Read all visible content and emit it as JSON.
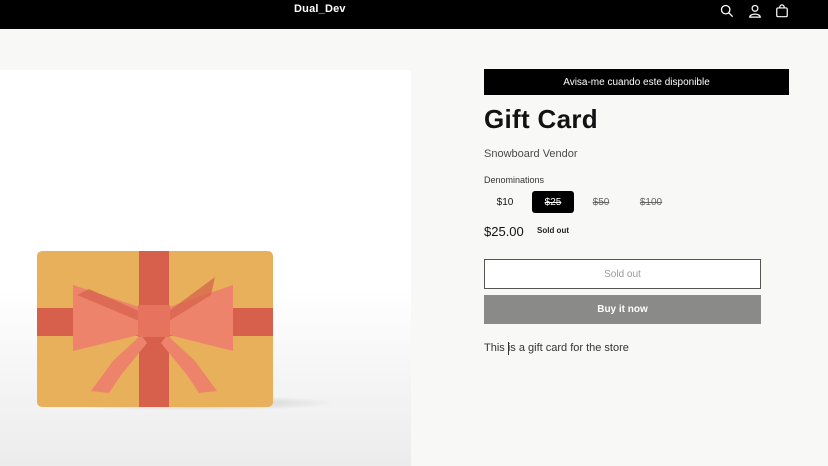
{
  "header": {
    "brand": "Dual_Dev",
    "icons": [
      "search-icon",
      "account-icon",
      "cart-icon"
    ]
  },
  "notify": {
    "label": "Avisa-me cuando este disponible"
  },
  "product": {
    "title": "Gift Card",
    "vendor": "Snowboard Vendor",
    "denominations_label": "Denominations",
    "denominations": [
      {
        "label": "$10",
        "selected": false,
        "struck": false
      },
      {
        "label": "$25",
        "selected": true,
        "struck": true
      },
      {
        "label": "$50",
        "selected": false,
        "struck": true
      },
      {
        "label": "$100",
        "selected": false,
        "struck": true
      }
    ],
    "price": "$25.00",
    "sold_out_badge": "Sold out",
    "sold_out_button": "Sold out",
    "buy_now": "Buy it now",
    "description": "This is a gift card for the store"
  },
  "colors": {
    "header_bg": "#000000",
    "card_body": "#E8B05A",
    "ribbon": "#D6604B",
    "bow": "#EE836B",
    "buy_button": "#8A8A88"
  }
}
